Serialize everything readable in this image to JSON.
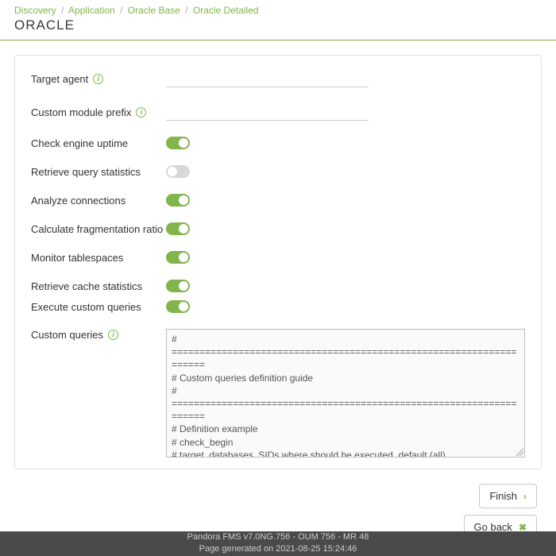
{
  "breadcrumb": {
    "items": [
      "Discovery",
      "Application",
      "Oracle Base",
      "Oracle Detailed"
    ]
  },
  "title": "ORACLE",
  "form": {
    "target_agent": {
      "label": "Target agent",
      "value": ""
    },
    "prefix": {
      "label": "Custom module prefix",
      "value": ""
    },
    "uptime": {
      "label": "Check engine uptime",
      "on": true
    },
    "query_stats": {
      "label": "Retrieve query statistics",
      "on": false
    },
    "analyze_conn": {
      "label": "Analyze connections",
      "on": true
    },
    "fragmentation": {
      "label": "Calculate fragmentation ratio",
      "on": true
    },
    "tablespaces": {
      "label": "Monitor tablespaces",
      "on": true
    },
    "cache_stats": {
      "label": "Retrieve cache statistics",
      "on": true
    },
    "exec_custom": {
      "label": "Execute custom queries",
      "on": true
    },
    "custom_queries": {
      "label": "Custom queries",
      "value": "# ====================================================================\n# Custom queries definition guide\n# ====================================================================\n# Definition example\n# check_begin\n# target_databases  SIDs where should be executed, default (all)\n# name              custom name chosen by the user\n# description      custom description chosen by the user\n# operation       value | full,\n#                 value returns a simple value"
    }
  },
  "actions": {
    "finish": "Finish",
    "goback": "Go back"
  },
  "footer": {
    "line1": "Pandora FMS v7.0NG.756 - OUM 756 - MR 48",
    "line2": "Page generated on 2021-08-25 15:24:46"
  }
}
